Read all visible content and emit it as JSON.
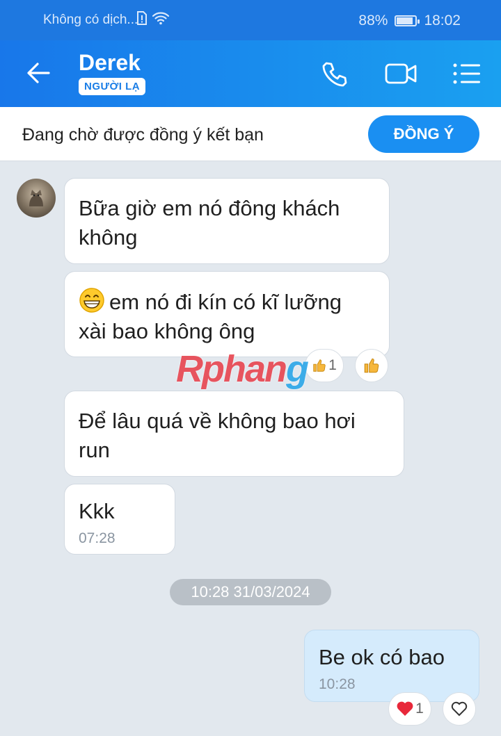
{
  "status_bar": {
    "carrier": "Không có dịch...",
    "battery": "88%",
    "battery_level": 0.88,
    "time": "18:02"
  },
  "header": {
    "name": "Derek",
    "badge": "NGƯỜI LẠ",
    "icons": [
      "back-arrow-icon",
      "phone-icon",
      "video-call-icon",
      "menu-icon"
    ]
  },
  "friend_request": {
    "text": "Đang chờ được đồng ý kết bạn",
    "button": "ĐỒNG Ý"
  },
  "messages": [
    {
      "from": "Derek",
      "text": "Bữa giờ em nó đông khách không"
    },
    {
      "from": "Derek",
      "emoji": "grin-emoji",
      "text": "em nó đi kín có kĩ lưỡng xài bao không ông",
      "reaction": {
        "icon": "thumbs-up-icon",
        "count": "1"
      }
    },
    {
      "from": "Derek",
      "text": "Để lâu quá về không bao hơi run"
    },
    {
      "from": "Derek",
      "text": "Kkk",
      "time": "07:28"
    },
    {
      "from": "me",
      "text": "Be ok có bao",
      "time": "10:28",
      "reaction": {
        "icon": "heart-icon",
        "count": "1"
      }
    }
  ],
  "date_separator": "10:28 31/03/2024",
  "watermark": {
    "part1": "Rphan",
    "part2": "g"
  },
  "colors": {
    "header": "#1a8ff2",
    "accent": "#1a8ff2",
    "my_bubble": "#d5ebfc",
    "background": "#e2e8ee"
  }
}
